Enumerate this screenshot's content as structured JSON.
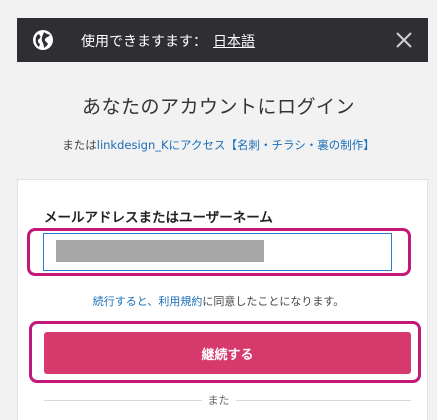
{
  "language_bar": {
    "message": "使用できますます：",
    "language_link": "日本語",
    "icons": {
      "globe": "globe-icon",
      "close": "close-icon"
    }
  },
  "login": {
    "title": "あなたのアカウントにログイン",
    "subtitle_prefix": "または",
    "subtitle_link": "linkdesign_Kにアクセス【名刺・チラシ・裏の制作】",
    "field_label": "メールアドレスまたはユーザーネーム",
    "email_value": "",
    "terms_link": "続行すると、利用規約",
    "terms_suffix": "に同意したことになります。",
    "continue_button": "継続する",
    "divider_text": "また"
  },
  "colors": {
    "bar_bg": "#2e2e33",
    "highlight": "#c4177a",
    "button": "#d6396c",
    "link": "#1a6fb8"
  }
}
